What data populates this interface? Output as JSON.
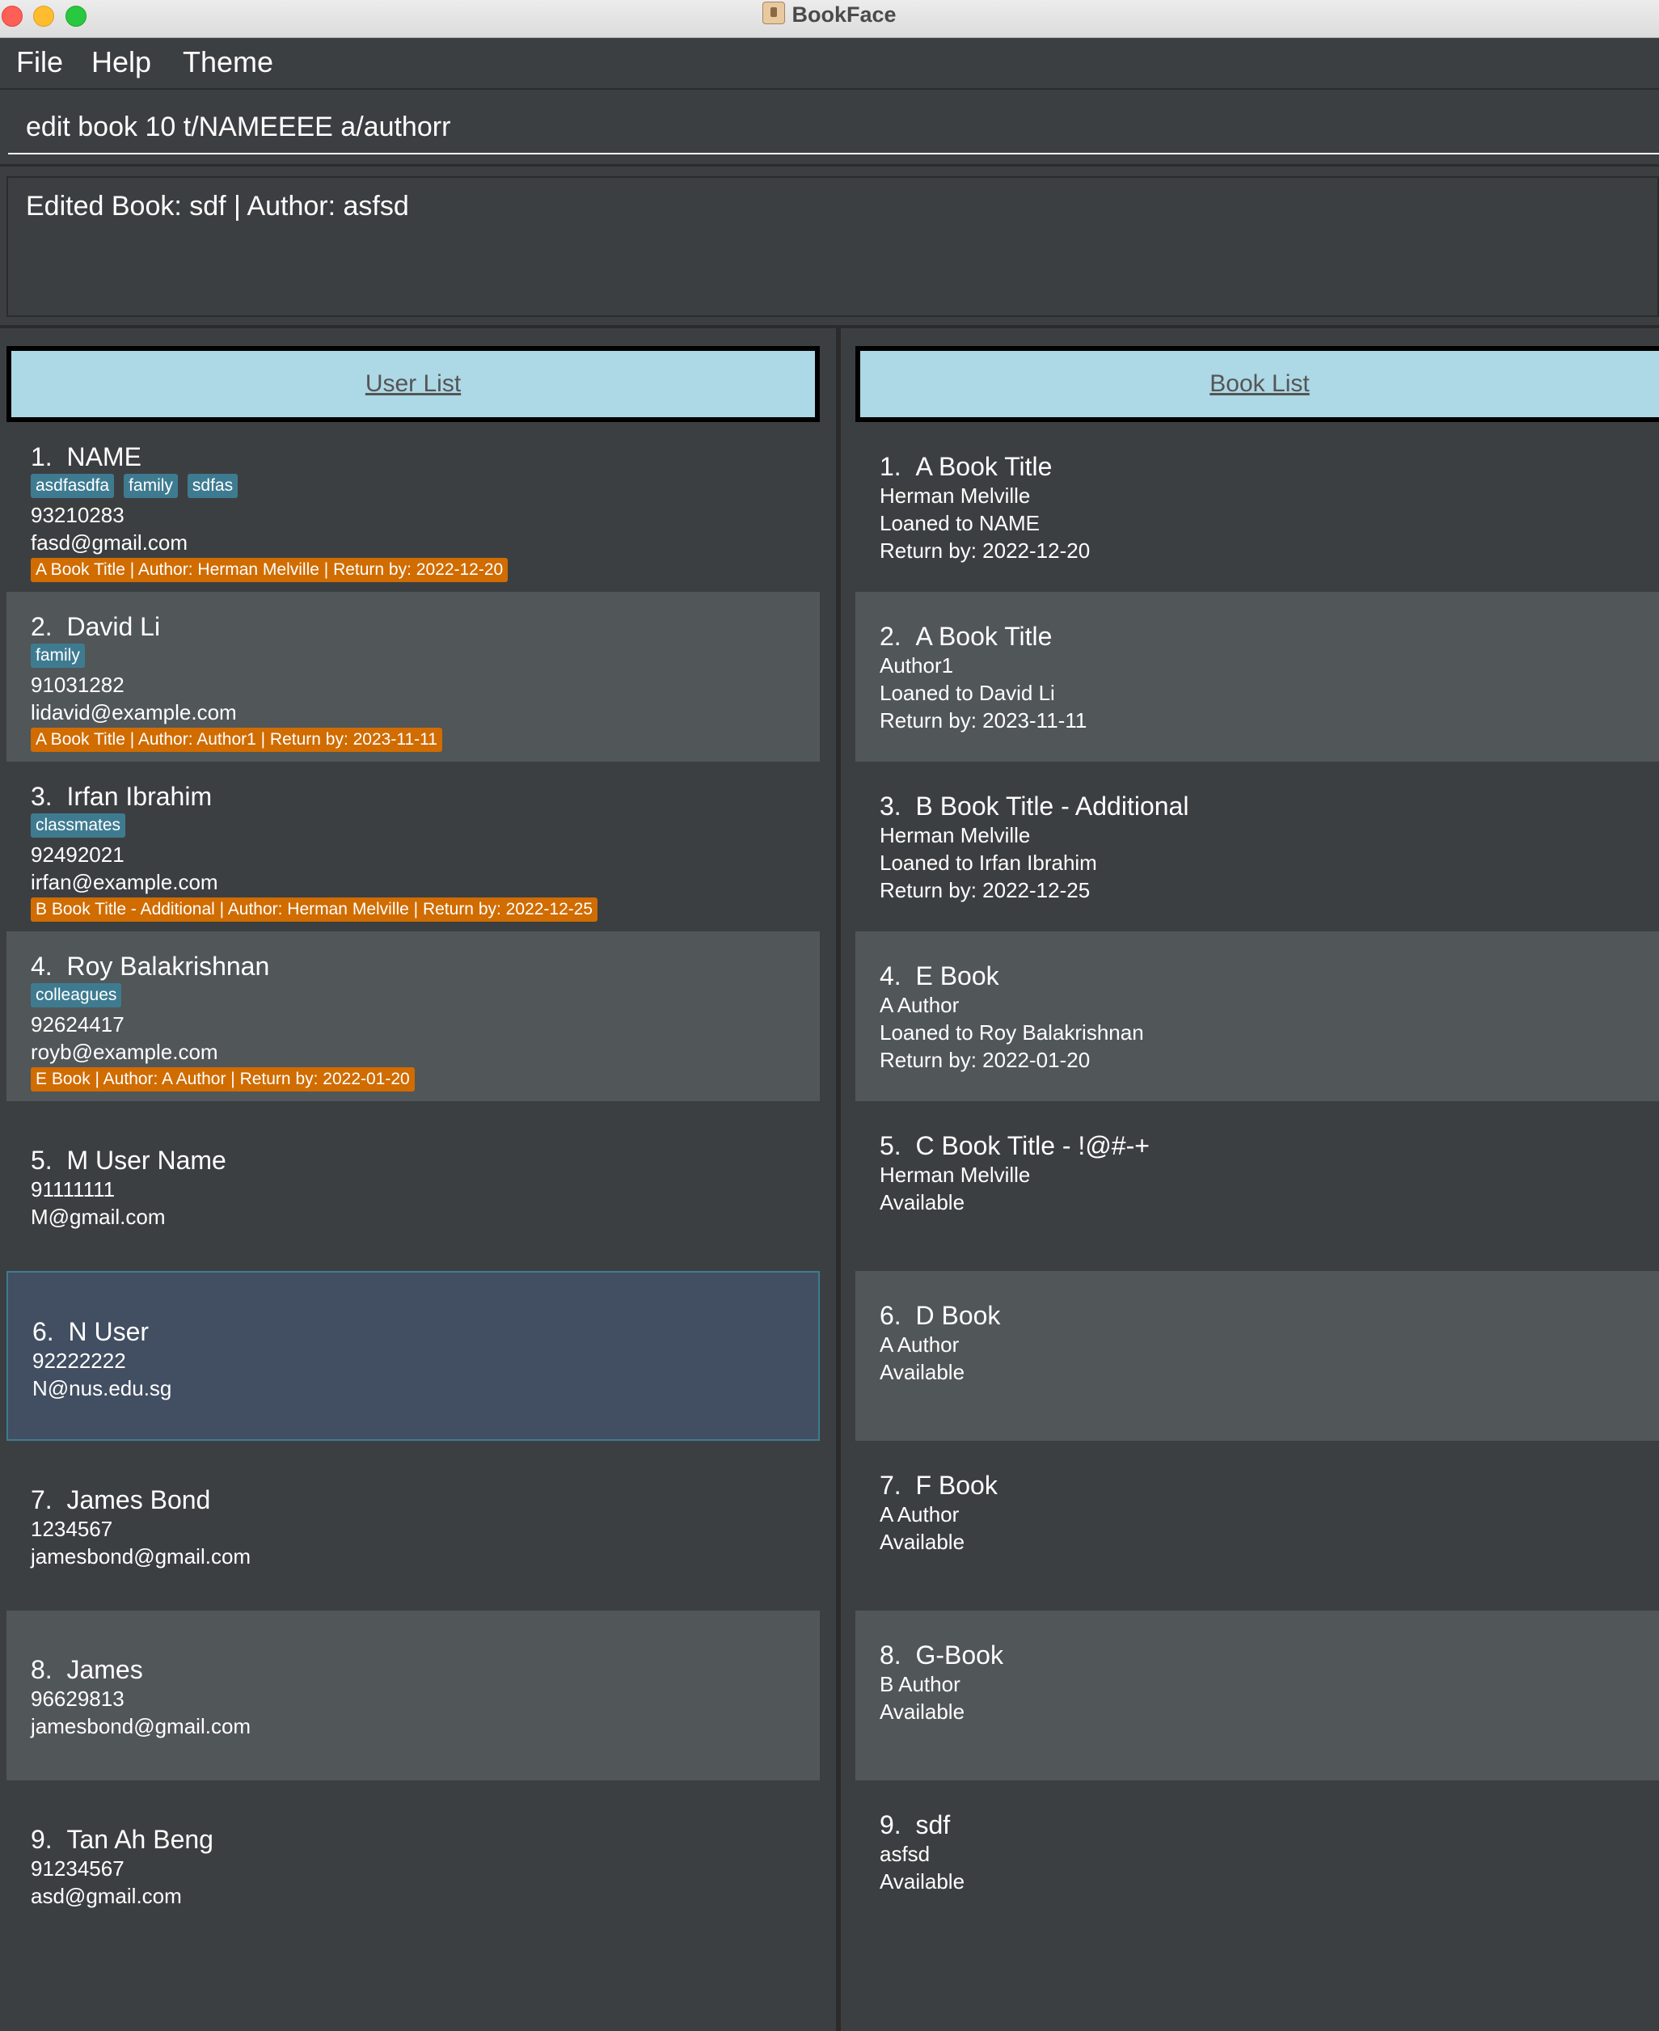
{
  "window": {
    "title": "BookFace"
  },
  "menu": [
    "File",
    "Help",
    "Theme"
  ],
  "command": {
    "value": "edit book 10 t/NAMEEEE a/authorr"
  },
  "result": {
    "text": "Edited Book: sdf | Author: asfsd"
  },
  "user_list": {
    "header": "User List",
    "items": [
      {
        "index": "1.",
        "name": "NAME",
        "tags": [
          "asdfasdfa",
          "family",
          "sdfas"
        ],
        "phone": "93210283",
        "email": "fasd@gmail.com",
        "loan": "A Book Title | Author: Herman Melville | Return by: 2022-12-20"
      },
      {
        "index": "2.",
        "name": "David Li",
        "tags": [
          "family"
        ],
        "phone": "91031282",
        "email": "lidavid@example.com",
        "loan": "A Book Title | Author: Author1 | Return by: 2023-11-11"
      },
      {
        "index": "3.",
        "name": "Irfan Ibrahim",
        "tags": [
          "classmates"
        ],
        "phone": "92492021",
        "email": "irfan@example.com",
        "loan": "B Book Title - Additional | Author: Herman Melville | Return by: 2022-12-25"
      },
      {
        "index": "4.",
        "name": "Roy Balakrishnan",
        "tags": [
          "colleagues"
        ],
        "phone": "92624417",
        "email": "royb@example.com",
        "loan": "E Book | Author: A Author | Return by: 2022-01-20"
      },
      {
        "index": "5.",
        "name": "M User Name",
        "tags": [],
        "phone": "91111111",
        "email": "M@gmail.com",
        "loan": ""
      },
      {
        "index": "6.",
        "name": "N User",
        "tags": [],
        "phone": "92222222",
        "email": "N@nus.edu.sg",
        "loan": ""
      },
      {
        "index": "7.",
        "name": "James Bond",
        "tags": [],
        "phone": "1234567",
        "email": "jamesbond@gmail.com",
        "loan": ""
      },
      {
        "index": "8.",
        "name": "James",
        "tags": [],
        "phone": "96629813",
        "email": "jamesbond@gmail.com",
        "loan": ""
      },
      {
        "index": "9.",
        "name": "Tan Ah Beng",
        "tags": [],
        "phone": "91234567",
        "email": "asd@gmail.com",
        "loan": ""
      }
    ]
  },
  "book_list": {
    "header": "Book List",
    "items": [
      {
        "index": "1.",
        "title": "A Book Title",
        "author": "Herman Melville",
        "status": "Loaned to NAME",
        "return_by": "Return by: 2022-12-20"
      },
      {
        "index": "2.",
        "title": "A Book Title",
        "author": "Author1",
        "status": "Loaned to David Li",
        "return_by": "Return by: 2023-11-11"
      },
      {
        "index": "3.",
        "title": "B Book Title - Additional",
        "author": "Herman Melville",
        "status": "Loaned to Irfan Ibrahim",
        "return_by": "Return by: 2022-12-25"
      },
      {
        "index": "4.",
        "title": "E Book",
        "author": "A Author",
        "status": "Loaned to Roy Balakrishnan",
        "return_by": "Return by: 2022-01-20"
      },
      {
        "index": "5.",
        "title": "C Book Title - !@#-+",
        "author": "Herman Melville",
        "status": "Available",
        "return_by": ""
      },
      {
        "index": "6.",
        "title": "D Book",
        "author": "A Author",
        "status": "Available",
        "return_by": ""
      },
      {
        "index": "7.",
        "title": "F Book",
        "author": "A Author",
        "status": "Available",
        "return_by": ""
      },
      {
        "index": "8.",
        "title": "G-Book",
        "author": "B Author",
        "status": "Available",
        "return_by": ""
      },
      {
        "index": "9.",
        "title": "sdf",
        "author": "asfsd",
        "status": "Available",
        "return_by": ""
      }
    ]
  },
  "colors": {
    "tag": "#3e7b91",
    "loan": "#d06c00",
    "header": "#add8e6",
    "selected": "#424e61"
  }
}
